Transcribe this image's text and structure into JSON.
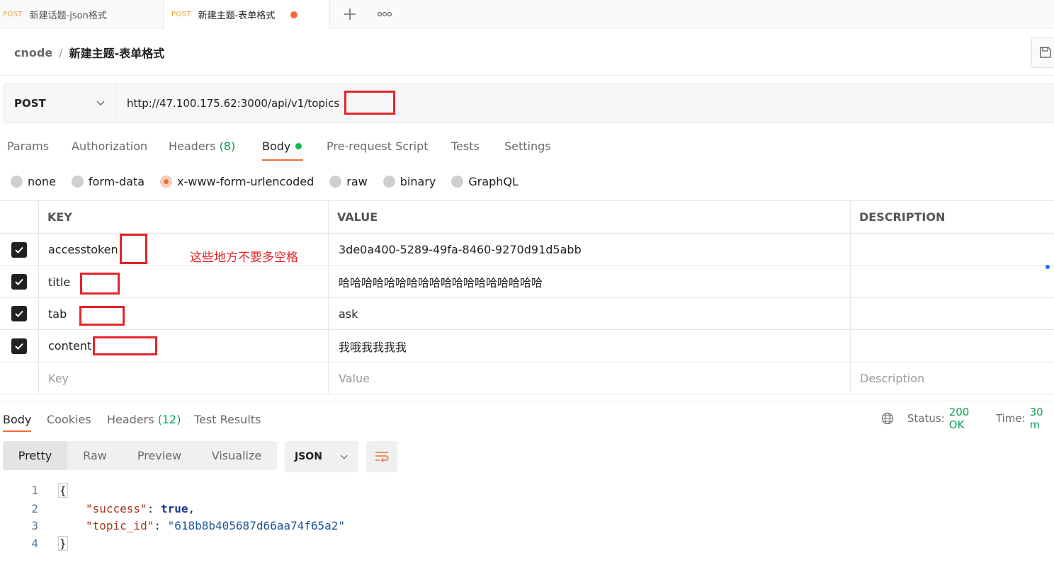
{
  "tabs": [
    {
      "method": "POST",
      "name": "新建话题-json格式",
      "active": false
    },
    {
      "method": "POST",
      "name": "新建主题-表单格式",
      "active": true
    }
  ],
  "tab_icons": {
    "add": "plus-icon",
    "more": "more-icon"
  },
  "breadcrumb": {
    "workspace": "cnode",
    "separator": "/",
    "request_name": "新建主题-表单格式"
  },
  "request": {
    "method": "POST",
    "url": "http://47.100.175.62:3000/api/v1/topics"
  },
  "request_tabs": [
    {
      "label": "Params"
    },
    {
      "label": "Authorization"
    },
    {
      "label": "Headers",
      "count": "(8)"
    },
    {
      "label": "Body",
      "active": true
    },
    {
      "label": "Pre-request Script"
    },
    {
      "label": "Tests"
    },
    {
      "label": "Settings"
    }
  ],
  "body_types": [
    {
      "label": "none",
      "selected": false
    },
    {
      "label": "form-data",
      "selected": false
    },
    {
      "label": "x-www-form-urlencoded",
      "selected": true
    },
    {
      "label": "raw",
      "selected": false
    },
    {
      "label": "binary",
      "selected": false
    },
    {
      "label": "GraphQL",
      "selected": false
    }
  ],
  "params_table": {
    "headers": {
      "key": "KEY",
      "value": "VALUE",
      "description": "DESCRIPTION"
    },
    "rows": [
      {
        "key": "accesstoken",
        "value": "3de0a400-5289-49fa-8460-9270d91d5abb",
        "description": "",
        "checked": true
      },
      {
        "key": "title",
        "value": "哈哈哈哈哈哈哈哈哈哈哈哈哈哈哈哈哈哈",
        "description": "",
        "checked": true
      },
      {
        "key": "tab",
        "value": "ask",
        "description": "",
        "checked": true
      },
      {
        "key": "content",
        "value": "我哦我我我我",
        "description": "",
        "checked": true
      }
    ],
    "placeholders": {
      "key": "Key",
      "value": "Value",
      "description": "Description"
    }
  },
  "annotation": "这些地方不要多空格",
  "response": {
    "tabs": [
      {
        "label": "Body",
        "active": true
      },
      {
        "label": "Cookies"
      },
      {
        "label": "Headers",
        "count": "(12)"
      },
      {
        "label": "Test Results"
      }
    ],
    "status_label": "Status:",
    "status_value": "200 OK",
    "time_label": "Time:",
    "time_value": "30 m",
    "view_modes": [
      "Pretty",
      "Raw",
      "Preview",
      "Visualize"
    ],
    "active_view": "Pretty",
    "language": "JSON",
    "code": {
      "line_numbers": [
        "1",
        "2",
        "3",
        "4"
      ],
      "open_brace": "{",
      "close_brace": "}",
      "key1": "\"success\"",
      "val1": "true",
      "key2": "\"topic_id\"",
      "val2": "\"618b8b405687d66aa74f65a2\""
    }
  },
  "colors": {
    "accent": "#f26b3a",
    "success": "#0f9d58",
    "annotation_red": "#e3242b",
    "method_post": "#e8a43a"
  }
}
